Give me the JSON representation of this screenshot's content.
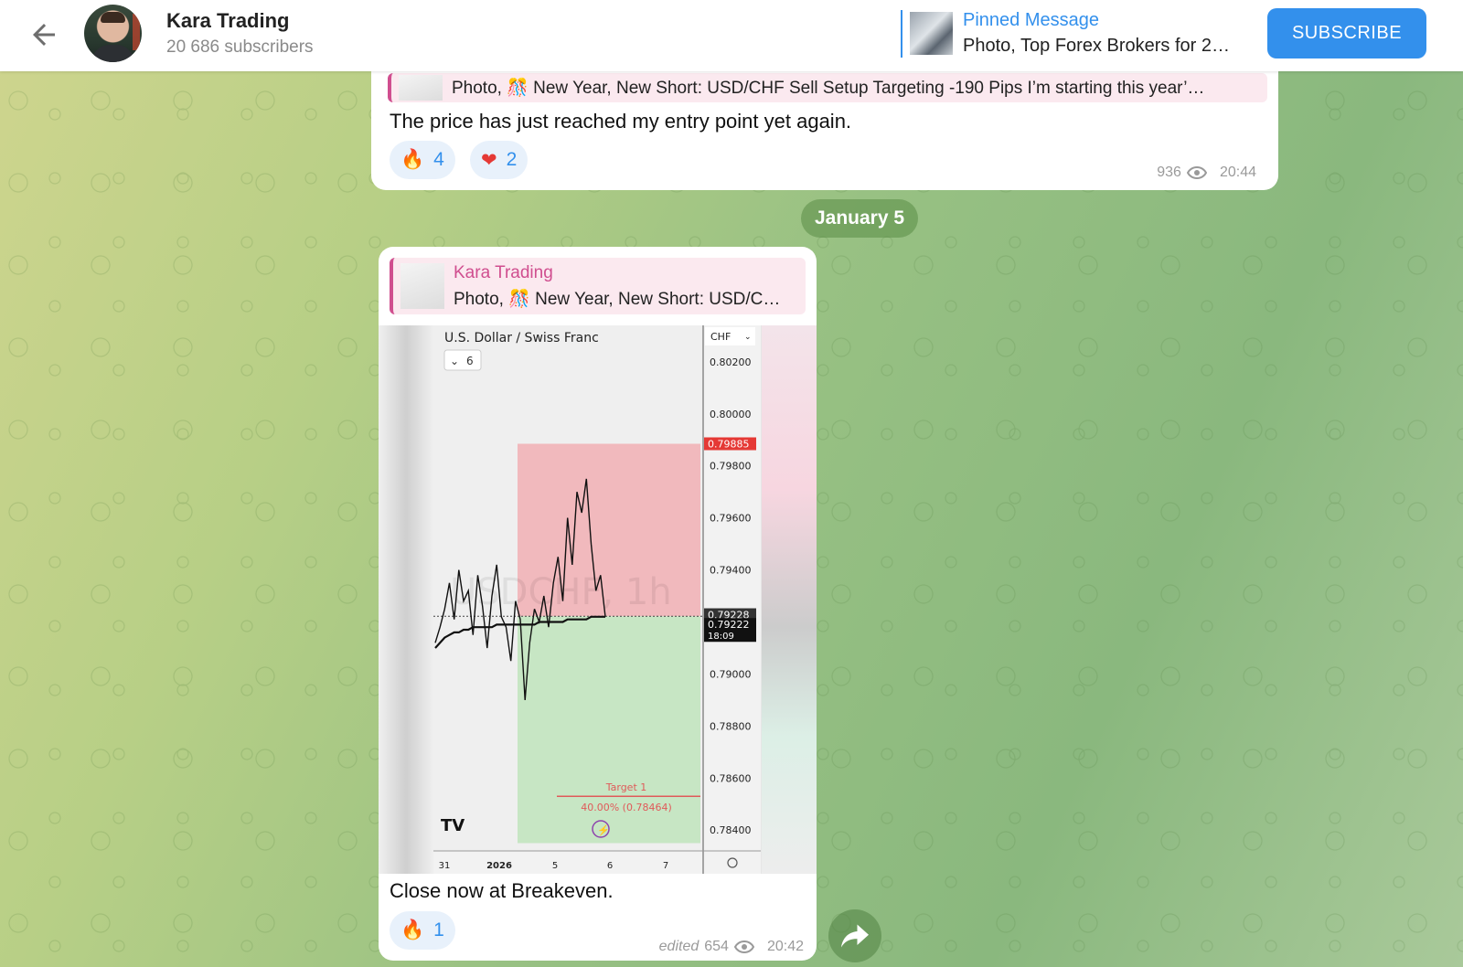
{
  "header": {
    "channel_name": "Kara Trading",
    "subscribers": "20 686 subscribers",
    "pinned_label": "Pinned Message",
    "pinned_text": "Photo, Top Forex Brokers for 2…",
    "subscribe_label": "SUBSCRIBE"
  },
  "message1": {
    "reply_text": "Photo, 🎊 New Year, New Short: USD/CHF Sell Setup Targeting -190 Pips I’m starting this year’…",
    "text": "The price has just reached my entry point yet again.",
    "reactions": [
      {
        "emoji": "🔥",
        "count": "4"
      },
      {
        "emoji": "❤",
        "count": "2"
      }
    ],
    "views": "936",
    "time": "20:44"
  },
  "date_separator": "January 5",
  "message2": {
    "reply_name": "Kara Trading",
    "reply_text": "Photo, 🎊 New Year, New Short: USD/C…",
    "text": "Close now at Breakeven.",
    "reactions": [
      {
        "emoji": "🔥",
        "count": "1"
      }
    ],
    "edited": "edited",
    "views": "654",
    "time": "20:42"
  },
  "chart_data": {
    "type": "line",
    "title": "U.S. Dollar / Swiss Franc",
    "interval_selector": "6",
    "currency": "CHF",
    "watermark": "USDCHF, 1h",
    "y_ticks": [
      "0.80200",
      "0.80000",
      "0.79800",
      "0.79600",
      "0.79400",
      "0.79000",
      "0.78800",
      "0.78600",
      "0.78400"
    ],
    "ylim": [
      0.7832,
      0.8034
    ],
    "x_ticks": [
      "31",
      "2026",
      "5",
      "6",
      "7"
    ],
    "price_labels": [
      {
        "value": 0.79885,
        "text": "0.79885",
        "color": "#e53935"
      },
      {
        "value": 0.79228,
        "text": "0.79228",
        "color": "#333333"
      },
      {
        "value": 0.79222,
        "text": "0.79222",
        "sub": "18:09",
        "color": "#111111"
      }
    ],
    "stop_zone": [
      0.79885,
      0.79222
    ],
    "target_zone": [
      0.79222,
      0.7835
    ],
    "target_line": {
      "label": "Target 1",
      "value_text": "40.00% (0.78464)",
      "value": 0.7853
    },
    "series": [
      {
        "name": "price",
        "values": [
          0.7912,
          0.7918,
          0.7925,
          0.7935,
          0.7921,
          0.794,
          0.7928,
          0.7932,
          0.7915,
          0.7938,
          0.7926,
          0.791,
          0.793,
          0.7942,
          0.7922,
          0.7918,
          0.7905,
          0.7928,
          0.7921,
          0.789,
          0.7912,
          0.7925,
          0.792,
          0.793,
          0.7918,
          0.7935,
          0.7945,
          0.7928,
          0.796,
          0.7942,
          0.797,
          0.7962,
          0.7975,
          0.795,
          0.7932,
          0.7938,
          0.7922
        ]
      },
      {
        "name": "ma",
        "values": [
          0.791,
          0.7912,
          0.7914,
          0.7915,
          0.7916,
          0.7916,
          0.7917,
          0.7917,
          0.7918,
          0.7918,
          0.7918,
          0.7918,
          0.7918,
          0.7919,
          0.7919,
          0.7919,
          0.7919,
          0.7919,
          0.7919,
          0.7919,
          0.7919,
          0.7919,
          0.792,
          0.792,
          0.792,
          0.792,
          0.792,
          0.792,
          0.7921,
          0.7921,
          0.7921,
          0.7921,
          0.7921,
          0.7922,
          0.7922,
          0.7922,
          0.7922
        ]
      }
    ]
  },
  "colors": {
    "accent": "#3390ec",
    "reply_accent": "#d04e8f",
    "stop_zone": "#f1b9bd",
    "target_zone": "#c7e6c4"
  }
}
